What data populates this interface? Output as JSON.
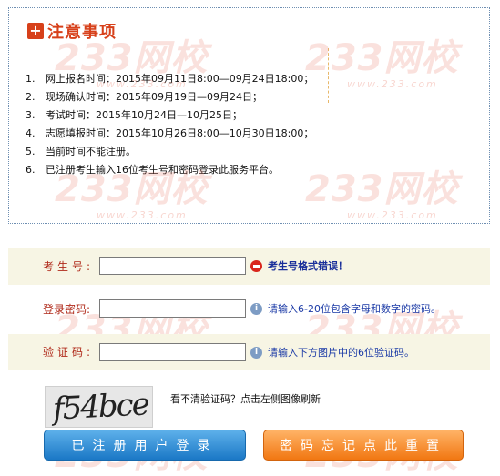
{
  "notice": {
    "title": "注意事项",
    "items": [
      {
        "num": "1.",
        "text": "网上报名时间：2015年09月11日8:00—09月24日18:00；"
      },
      {
        "num": "2.",
        "text": "现场确认时间：2015年09月19日—09月24日；"
      },
      {
        "num": "3.",
        "text": "考试时间：2015年10月24日—10月25日；"
      },
      {
        "num": "4.",
        "text": "志愿填报时间：2015年10月26日8:00—10月30日18:00；"
      },
      {
        "num": "5.",
        "text": "当前时间不能注册。"
      },
      {
        "num": "6.",
        "text": "已注册考生输入16位考生号和密码登录此服务平台。"
      }
    ]
  },
  "watermark": {
    "brand": "233网校",
    "url": "www.233.com"
  },
  "form": {
    "exam_number": {
      "label": "考生号:",
      "value": "",
      "hint": "考生号格式错误！"
    },
    "password": {
      "label": "登录密码:",
      "value": "",
      "hint": "请输入6-20位包含字母和数字的密码。"
    },
    "captcha": {
      "label": "验证码:",
      "value": "",
      "hint": "请输入下方图片中的6位验证码。",
      "image_text": "f54bce",
      "refresh_tip": "看不清验证码？点击左侧图像刷新"
    }
  },
  "buttons": {
    "login": "已注册用户登录",
    "reset": "密码忘记点此重置"
  },
  "colors": {
    "accent_red": "#d7401a",
    "login_blue": "#1b78c6",
    "reset_orange": "#f17712",
    "hint_blue": "#1b3aa6"
  }
}
